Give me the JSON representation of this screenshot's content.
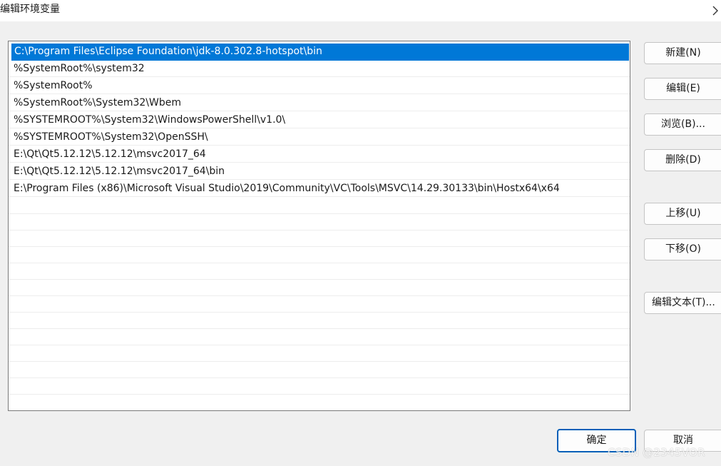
{
  "window": {
    "title": "编辑环境变量",
    "close_icon": "chevron-right-icon"
  },
  "path_list": {
    "selected_index": 0,
    "items": [
      "C:\\Program Files\\Eclipse Foundation\\jdk-8.0.302.8-hotspot\\bin",
      "%SystemRoot%\\system32",
      "%SystemRoot%",
      "%SystemRoot%\\System32\\Wbem",
      "%SYSTEMROOT%\\System32\\WindowsPowerShell\\v1.0\\",
      "%SYSTEMROOT%\\System32\\OpenSSH\\",
      "E:\\Qt\\Qt5.12.12\\5.12.12\\msvc2017_64",
      "E:\\Qt\\Qt5.12.12\\5.12.12\\msvc2017_64\\bin",
      "E:\\Program Files (x86)\\Microsoft Visual Studio\\2019\\Community\\VC\\Tools\\MSVC\\14.29.30133\\bin\\Hostx64\\x64"
    ]
  },
  "buttons": {
    "new": "新建(N)",
    "edit": "编辑(E)",
    "browse": "浏览(B)...",
    "delete": "删除(D)",
    "move_up": "上移(U)",
    "move_down": "下移(O)",
    "edit_text": "编辑文本(T)...",
    "ok": "确定",
    "cancel": "取消"
  },
  "watermark": "CSDN @2345VOR",
  "colors": {
    "selection": "#0078d7",
    "default_button_border": "#005fb8",
    "dialog_background": "#f0f0f0"
  }
}
